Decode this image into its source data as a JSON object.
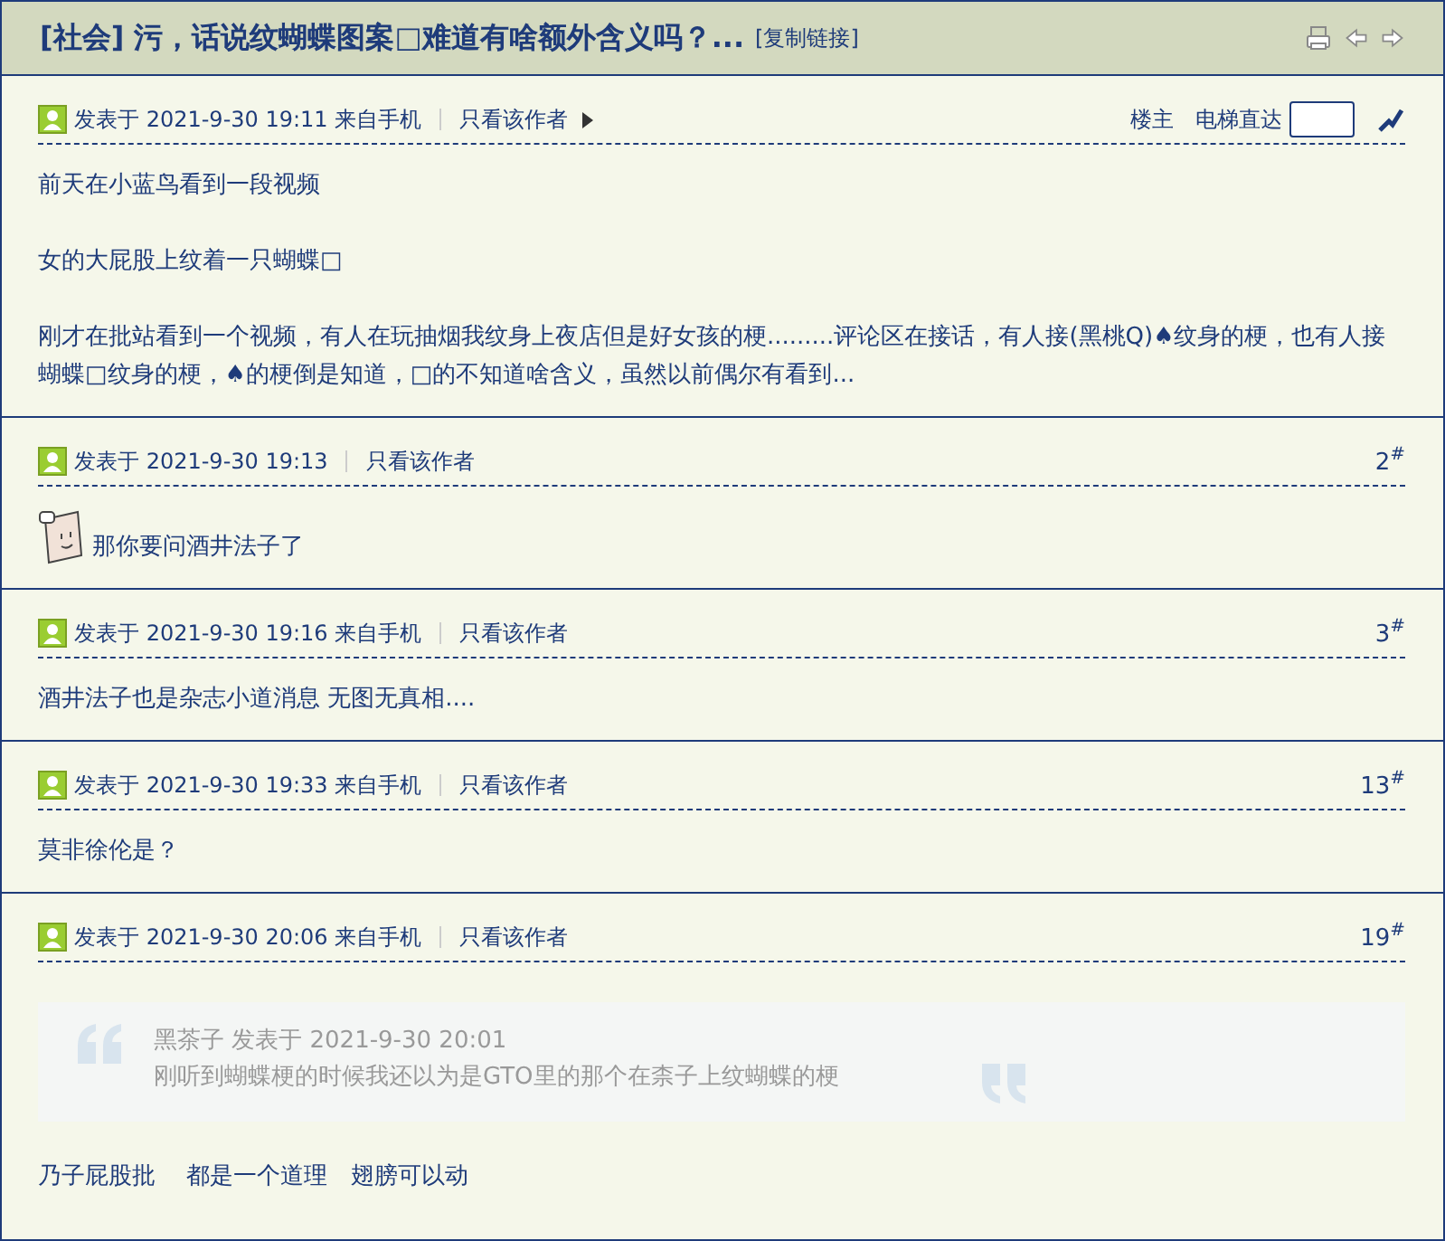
{
  "header": {
    "title": "[社会] 污，话说纹蝴蝶图案□难道有啥额外含义吗？...",
    "copy_link": "[复制链接]"
  },
  "posts": [
    {
      "meta": "发表于 2021-9-30 19:11 来自手机",
      "author_only": "只看该作者",
      "has_next_arrow": true,
      "op_label": "楼主",
      "jump_label": "电梯直达",
      "content": [
        {
          "kind": "text",
          "text": "前天在小蓝鸟看到一段视频"
        },
        {
          "kind": "text",
          "text": "女的大屁股上纹着一只蝴蝶□"
        },
        {
          "kind": "text",
          "text": "刚才在批站看到一个视频，有人在玩抽烟我纹身上夜店但是好女孩的梗.........评论区在接话，有人接(黑桃Q)♠纹身的梗，也有人接蝴蝶□纹身的梗，♠的梗倒是知道，□的不知道啥含义，虽然以前偶尔有看到..."
        }
      ]
    },
    {
      "meta": "发表于 2021-9-30 19:13",
      "author_only": "只看该作者",
      "has_next_arrow": false,
      "floor": "2$^{#}$",
      "content": [
        {
          "kind": "emoticon",
          "text": "那你要问酒井法子了"
        }
      ]
    },
    {
      "meta": "发表于 2021-9-30 19:16 来自手机",
      "author_only": "只看该作者",
      "has_next_arrow": false,
      "floor": "3$^{#}$",
      "content": [
        {
          "kind": "text",
          "text": "酒井法子也是杂志小道消息 无图无真相...."
        }
      ]
    },
    {
      "meta": "发表于 2021-9-30 19:33 来自手机",
      "author_only": "只看该作者",
      "has_next_arrow": false,
      "floor": "13$^{#}$",
      "content": [
        {
          "kind": "text",
          "text": "莫非徐伦是？"
        }
      ]
    },
    {
      "meta": "发表于 2021-9-30 20:06 来自手机",
      "author_only": "只看该作者",
      "has_next_arrow": false,
      "floor": "19$^{#}$",
      "content": [
        {
          "kind": "quote",
          "author": "黑茶子 发表于 2021-9-30 20:01",
          "text": "刚听到蝴蝶梗的时候我还以为是GTO里的那个在柰子上纹蝴蝶的梗"
        },
        {
          "kind": "text",
          "text": "乃子屁股批　 都是一个道理　翅膀可以动"
        }
      ]
    }
  ]
}
